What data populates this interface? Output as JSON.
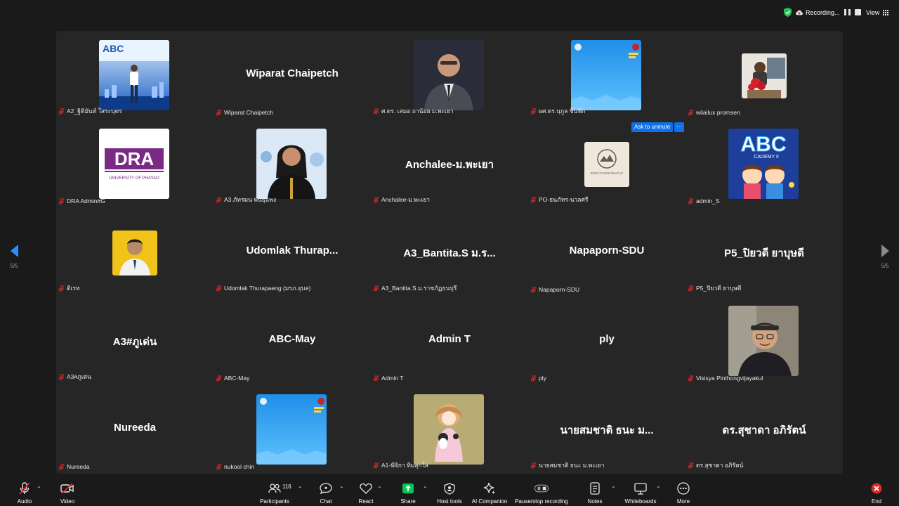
{
  "status": {
    "recording_label": "Recording...",
    "view_label": "View"
  },
  "pager": {
    "left_page": "5/5",
    "right_page": "5/5"
  },
  "participants": [
    {
      "display_name": "",
      "caption": "A2_ฐิติมันท์  ใสระบุตร",
      "tile": "photo",
      "photo": "banner-person"
    },
    {
      "display_name": "Wiparat Chaipetch",
      "caption": "Wiparat Chaipetch",
      "tile": "name"
    },
    {
      "display_name": "",
      "caption": "ศ.ดร. เสมอ ถาน้อย ม.พะเยา",
      "tile": "photo",
      "photo": "portrait-man"
    },
    {
      "display_name": "",
      "caption": "ผศ.ดร.นุกูล ชิ้นฟัก",
      "tile": "photo",
      "photo": "blue-poster"
    },
    {
      "display_name": "",
      "caption": "wilailux promsen",
      "tile": "photo-small",
      "photo": "bouquet"
    },
    {
      "display_name": "",
      "caption": "DRA Admin#G",
      "tile": "photo",
      "photo": "dra-logo",
      "logo_text": "DRA",
      "logo_sub": "UNIVERSITY OF PHAYAO"
    },
    {
      "display_name": "",
      "caption": "A3.ภัทรมน พันธุ์แพง",
      "tile": "photo",
      "photo": "portrait-woman"
    },
    {
      "display_name": "Anchalee-ม.พะเยา",
      "caption": "Anchalee-ม.พะเยา",
      "tile": "name"
    },
    {
      "display_name": "",
      "caption": "PO-ธนภัทร-นวลศรี",
      "tile": "photo-small",
      "photo": "studio-logo",
      "logo_text": "BENZ STUDIO PHAYAO"
    },
    {
      "display_name": "",
      "caption": "admin_S",
      "tile": "photo",
      "photo": "abc-cartoon",
      "logo_text": "ABC",
      "logo_sub": "CADEMY II"
    },
    {
      "display_name": "",
      "caption": "ติเรท",
      "tile": "photo-small",
      "photo": "portrait-yellow"
    },
    {
      "display_name": "Udomlak  Thurap...",
      "caption": "Udomlak Thurapaeng (มรภ.อุบล)",
      "tile": "name"
    },
    {
      "display_name": "A3_Bantita.S ม.ร...",
      "caption": "A3_Bantita.S ม.ราชภัฏธนบุรี",
      "tile": "name"
    },
    {
      "display_name": "Napaporn-SDU",
      "caption": "Napaporn-SDU",
      "tile": "name"
    },
    {
      "display_name": "P5_ปิยวดี  ยาบุษดี",
      "caption": "P5_ปิยวดี  ยาบุษดี",
      "tile": "name"
    },
    {
      "display_name": "A3#ภูเด่น",
      "caption": "A3#ภูเด่น",
      "tile": "name"
    },
    {
      "display_name": "ABC-May",
      "caption": "ABC-May",
      "tile": "name"
    },
    {
      "display_name": "Admin T",
      "caption": "Admin T",
      "tile": "name"
    },
    {
      "display_name": "ply",
      "caption": "ply",
      "tile": "name"
    },
    {
      "display_name": "",
      "caption": "Visisya Pinthongvijayakul",
      "tile": "photo",
      "photo": "selfie-headband"
    },
    {
      "display_name": "Nureeda",
      "caption": "Nureeda",
      "tile": "name"
    },
    {
      "display_name": "",
      "caption": "nukool chin",
      "tile": "photo",
      "photo": "blue-poster"
    },
    {
      "display_name": "",
      "caption": "A1-พิจิกา ทิมสุกใส",
      "tile": "photo",
      "photo": "illustration-girl"
    },
    {
      "display_name": "นายสมชาติ ธนะ ม...",
      "caption": "นายสมชาติ ธนะ ม.พะเยา",
      "tile": "name"
    },
    {
      "display_name": "ดร.สุชาดา อภิรัตน์",
      "caption": "ดร.สุชาดา อภิรัตน์",
      "tile": "name"
    }
  ],
  "popup": {
    "ask_unmute": "Ask to unmute",
    "more": "···"
  },
  "toolbar": {
    "audio": "Audio",
    "video": "Video",
    "participants": "Participants",
    "participant_count": "116",
    "chat": "Chat",
    "react": "React",
    "share": "Share",
    "host_tools": "Host tools",
    "ai_companion": "AI Companion",
    "pause_recording": "Pause/stop recording",
    "notes": "Notes",
    "whiteboards": "Whiteboards",
    "more": "More",
    "end": "End"
  },
  "colors": {
    "accent": "#0e71eb",
    "share": "#00c853",
    "end": "#e02828",
    "mic_off": "#e02828"
  }
}
